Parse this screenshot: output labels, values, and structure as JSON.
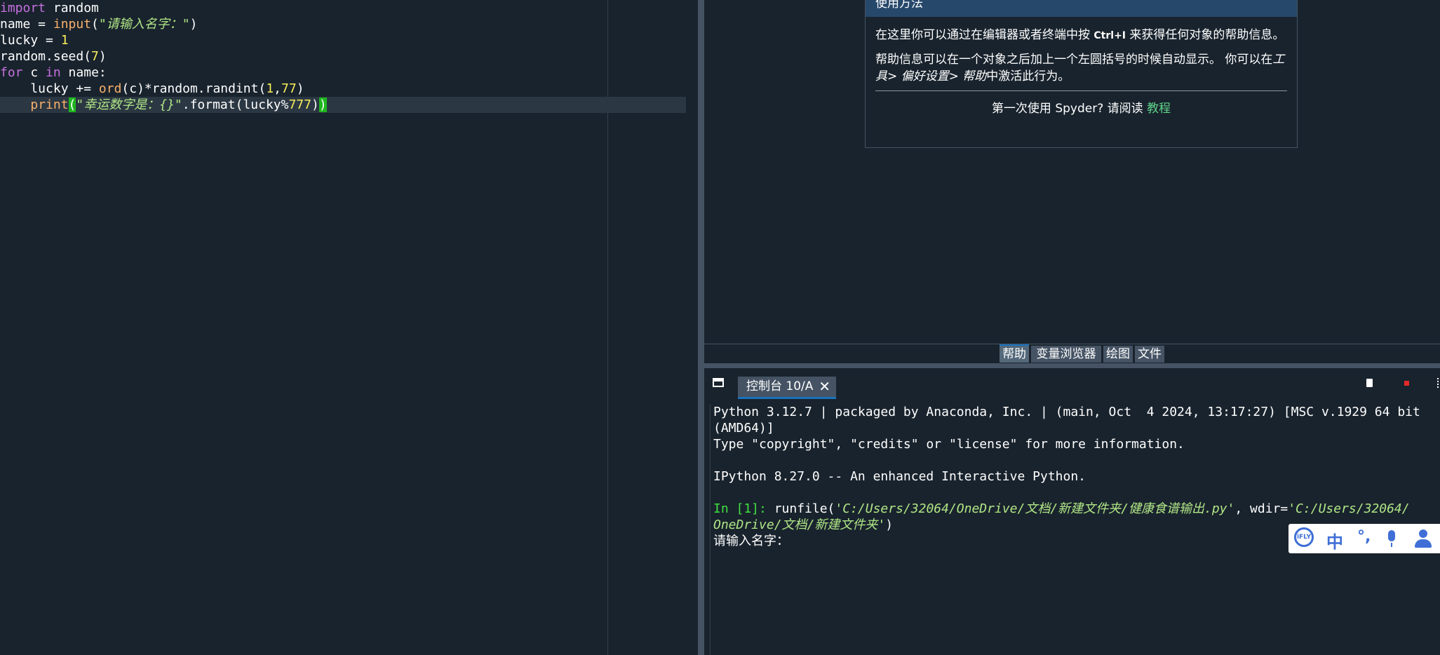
{
  "editor": {
    "lines": [
      [
        {
          "t": "import",
          "c": "kw"
        },
        {
          "t": " random",
          "c": ""
        }
      ],
      [
        {
          "t": "name = ",
          "c": ""
        },
        {
          "t": "input",
          "c": "bi"
        },
        {
          "t": "(",
          "c": ""
        },
        {
          "t": "\"请输入名字：\"",
          "c": "str"
        },
        {
          "t": ")",
          "c": ""
        }
      ],
      [
        {
          "t": "lucky = ",
          "c": ""
        },
        {
          "t": "1",
          "c": "num"
        }
      ],
      [
        {
          "t": "random.seed(",
          "c": ""
        },
        {
          "t": "7",
          "c": "num"
        },
        {
          "t": ")",
          "c": ""
        }
      ],
      [
        {
          "t": "for",
          "c": "kw"
        },
        {
          "t": " c ",
          "c": ""
        },
        {
          "t": "in",
          "c": "kw"
        },
        {
          "t": " name:",
          "c": ""
        }
      ],
      [
        {
          "t": "    lucky += ",
          "c": ""
        },
        {
          "t": "ord",
          "c": "bi"
        },
        {
          "t": "(c)*random.randint(",
          "c": ""
        },
        {
          "t": "1",
          "c": "num"
        },
        {
          "t": ",",
          "c": ""
        },
        {
          "t": "77",
          "c": "num"
        },
        {
          "t": ")",
          "c": ""
        }
      ],
      [
        {
          "t": "    ",
          "c": ""
        },
        {
          "t": "print",
          "c": "bi"
        },
        {
          "t": "(",
          "c": "hl"
        },
        {
          "t": "\"幸运数字是：{}\"",
          "c": "str"
        },
        {
          "t": ".format(lucky%",
          "c": ""
        },
        {
          "t": "777",
          "c": "num"
        },
        {
          "t": ")",
          "c": ""
        },
        {
          "t": ")",
          "c": "hl"
        }
      ]
    ]
  },
  "help": {
    "header": "使用方法",
    "p1_a": "在这里你可以通过在编辑器或者终端中按",
    "p1_key": "Ctrl+I",
    "p1_b": "来获得任何对象的帮助信息。",
    "p2_a": "帮助信息可以在一个对象之后加上一个左圆括号的时候自动显示。 你可以在",
    "p2_em": "工具> 偏好设置> 帮助",
    "p2_b": "中激活此行为。",
    "footer_a": "第一次使用 Spyder? 请阅读",
    "footer_link": "教程"
  },
  "pane_tabs": [
    "帮助",
    "变量浏览器",
    "绘图",
    "文件"
  ],
  "console": {
    "tab_label": "控制台 10/A",
    "lines": [
      "Python 3.12.7 | packaged by Anaconda, Inc. | (main, Oct  4 2024, 13:17:27) [MSC v.1929 64 bit",
      "(AMD64)]",
      "Type \"copyright\", \"credits\" or \"license\" for more information.",
      "",
      "IPython 8.27.0 -- An enhanced Interactive Python.",
      ""
    ],
    "prompt": "In [1]:",
    "run_a": " runfile(",
    "run_path": "'C:/Users/32064/OneDrive/文档/新建文件夹/健康食谱输出.py'",
    "run_b": ", wdir=",
    "run_wdir1": "'C:/Users/32064/",
    "run_wdir2": "OneDrive/文档/新建文件夹'",
    "run_c": ")",
    "input_prompt": "请输入名字："
  },
  "ime": {
    "logo": "iFLY",
    "mode": "中",
    "punct": "°,"
  }
}
